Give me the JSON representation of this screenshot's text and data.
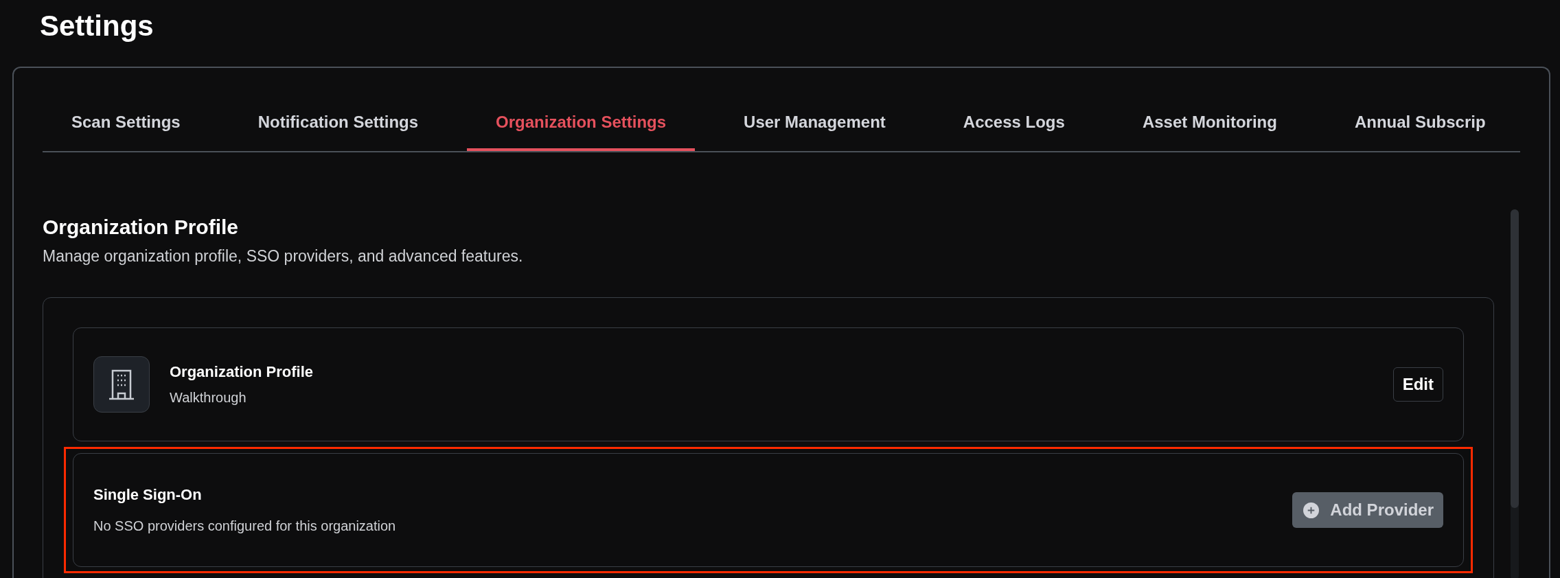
{
  "page": {
    "title": "Settings"
  },
  "tabs": [
    {
      "label": "Scan Settings",
      "selected": false
    },
    {
      "label": "Notification Settings",
      "selected": false
    },
    {
      "label": "Organization Settings",
      "selected": true
    },
    {
      "label": "User Management",
      "selected": false
    },
    {
      "label": "Access Logs",
      "selected": false
    },
    {
      "label": "Asset Monitoring",
      "selected": false
    },
    {
      "label": "Annual Subscrip",
      "selected": false
    }
  ],
  "section": {
    "title": "Organization Profile",
    "description": "Manage organization profile, SSO providers, and advanced features."
  },
  "cards": [
    {
      "kind": "profile",
      "title": "Organization Profile",
      "subtitle": "Walkthrough",
      "action": {
        "label": "Edit",
        "disabled": false
      },
      "highlighted": false
    },
    {
      "kind": "sso",
      "title": "Single Sign-On",
      "subtitle": "No SSO providers configured for this organization",
      "action": {
        "label": "Add Provider",
        "disabled": true
      },
      "highlighted": true
    }
  ]
}
